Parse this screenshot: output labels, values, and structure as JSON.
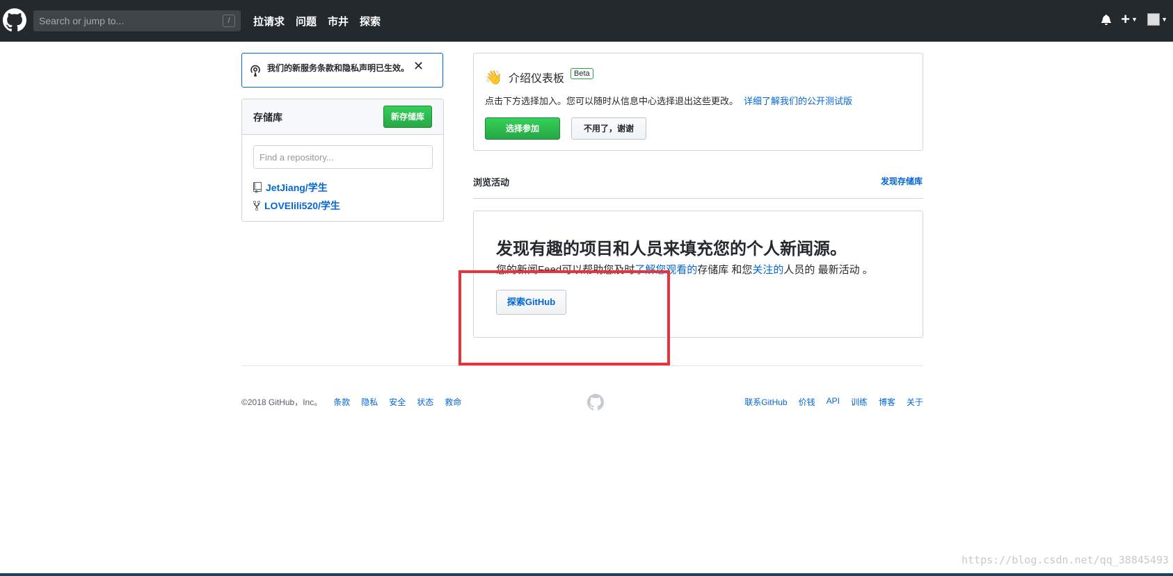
{
  "header": {
    "search_placeholder": "Search or jump to...",
    "slash_key": "/",
    "nav": [
      "拉请求",
      "问题",
      "市井",
      "探索"
    ]
  },
  "flash": {
    "message": "我们的新服务条款和隐私声明已生效。",
    "close": "✕"
  },
  "repos": {
    "title": "存储库",
    "new_button": "新存储库",
    "filter_placeholder": "Find a repository...",
    "items": [
      "JetJiang/学生",
      "LOVElili520/学生"
    ]
  },
  "intro": {
    "title": "介绍仪表板",
    "badge": "Beta",
    "description": "点击下方选择加入。您可以随时从信息中心选择退出这些更改。",
    "learn_link": "详细了解我们的公开测试版",
    "opt_in": "选择参加",
    "decline": "不用了，谢谢"
  },
  "activity": {
    "title": "浏览活动",
    "discover": "发现存储库"
  },
  "newsfeed": {
    "heading": "发现有趣的项目和人员来填充您的个人新闻源。",
    "p_start": "您的新闻Feed可以帮助您及时",
    "p_link1": "了解",
    "p_link2": "您观看的",
    "p_mid": "存储库 和您",
    "p_link3": "关注的",
    "p_end": "人员的 最新活动 。",
    "explore_button": "探索GitHub"
  },
  "footer": {
    "copyright": "©2018 GitHub，Inc。",
    "left_links": [
      "条款",
      "隐私",
      "安全",
      "状态",
      "救命"
    ],
    "right_links": [
      "联系GitHub",
      "价钱",
      "API",
      "训练",
      "博客",
      "关于"
    ]
  },
  "watermark": "https://blog.csdn.net/qq_38845493",
  "colors": {
    "header_bg": "#24292e",
    "link": "#0366d6",
    "green": "#28a745",
    "highlight_box": "#e8333a"
  }
}
